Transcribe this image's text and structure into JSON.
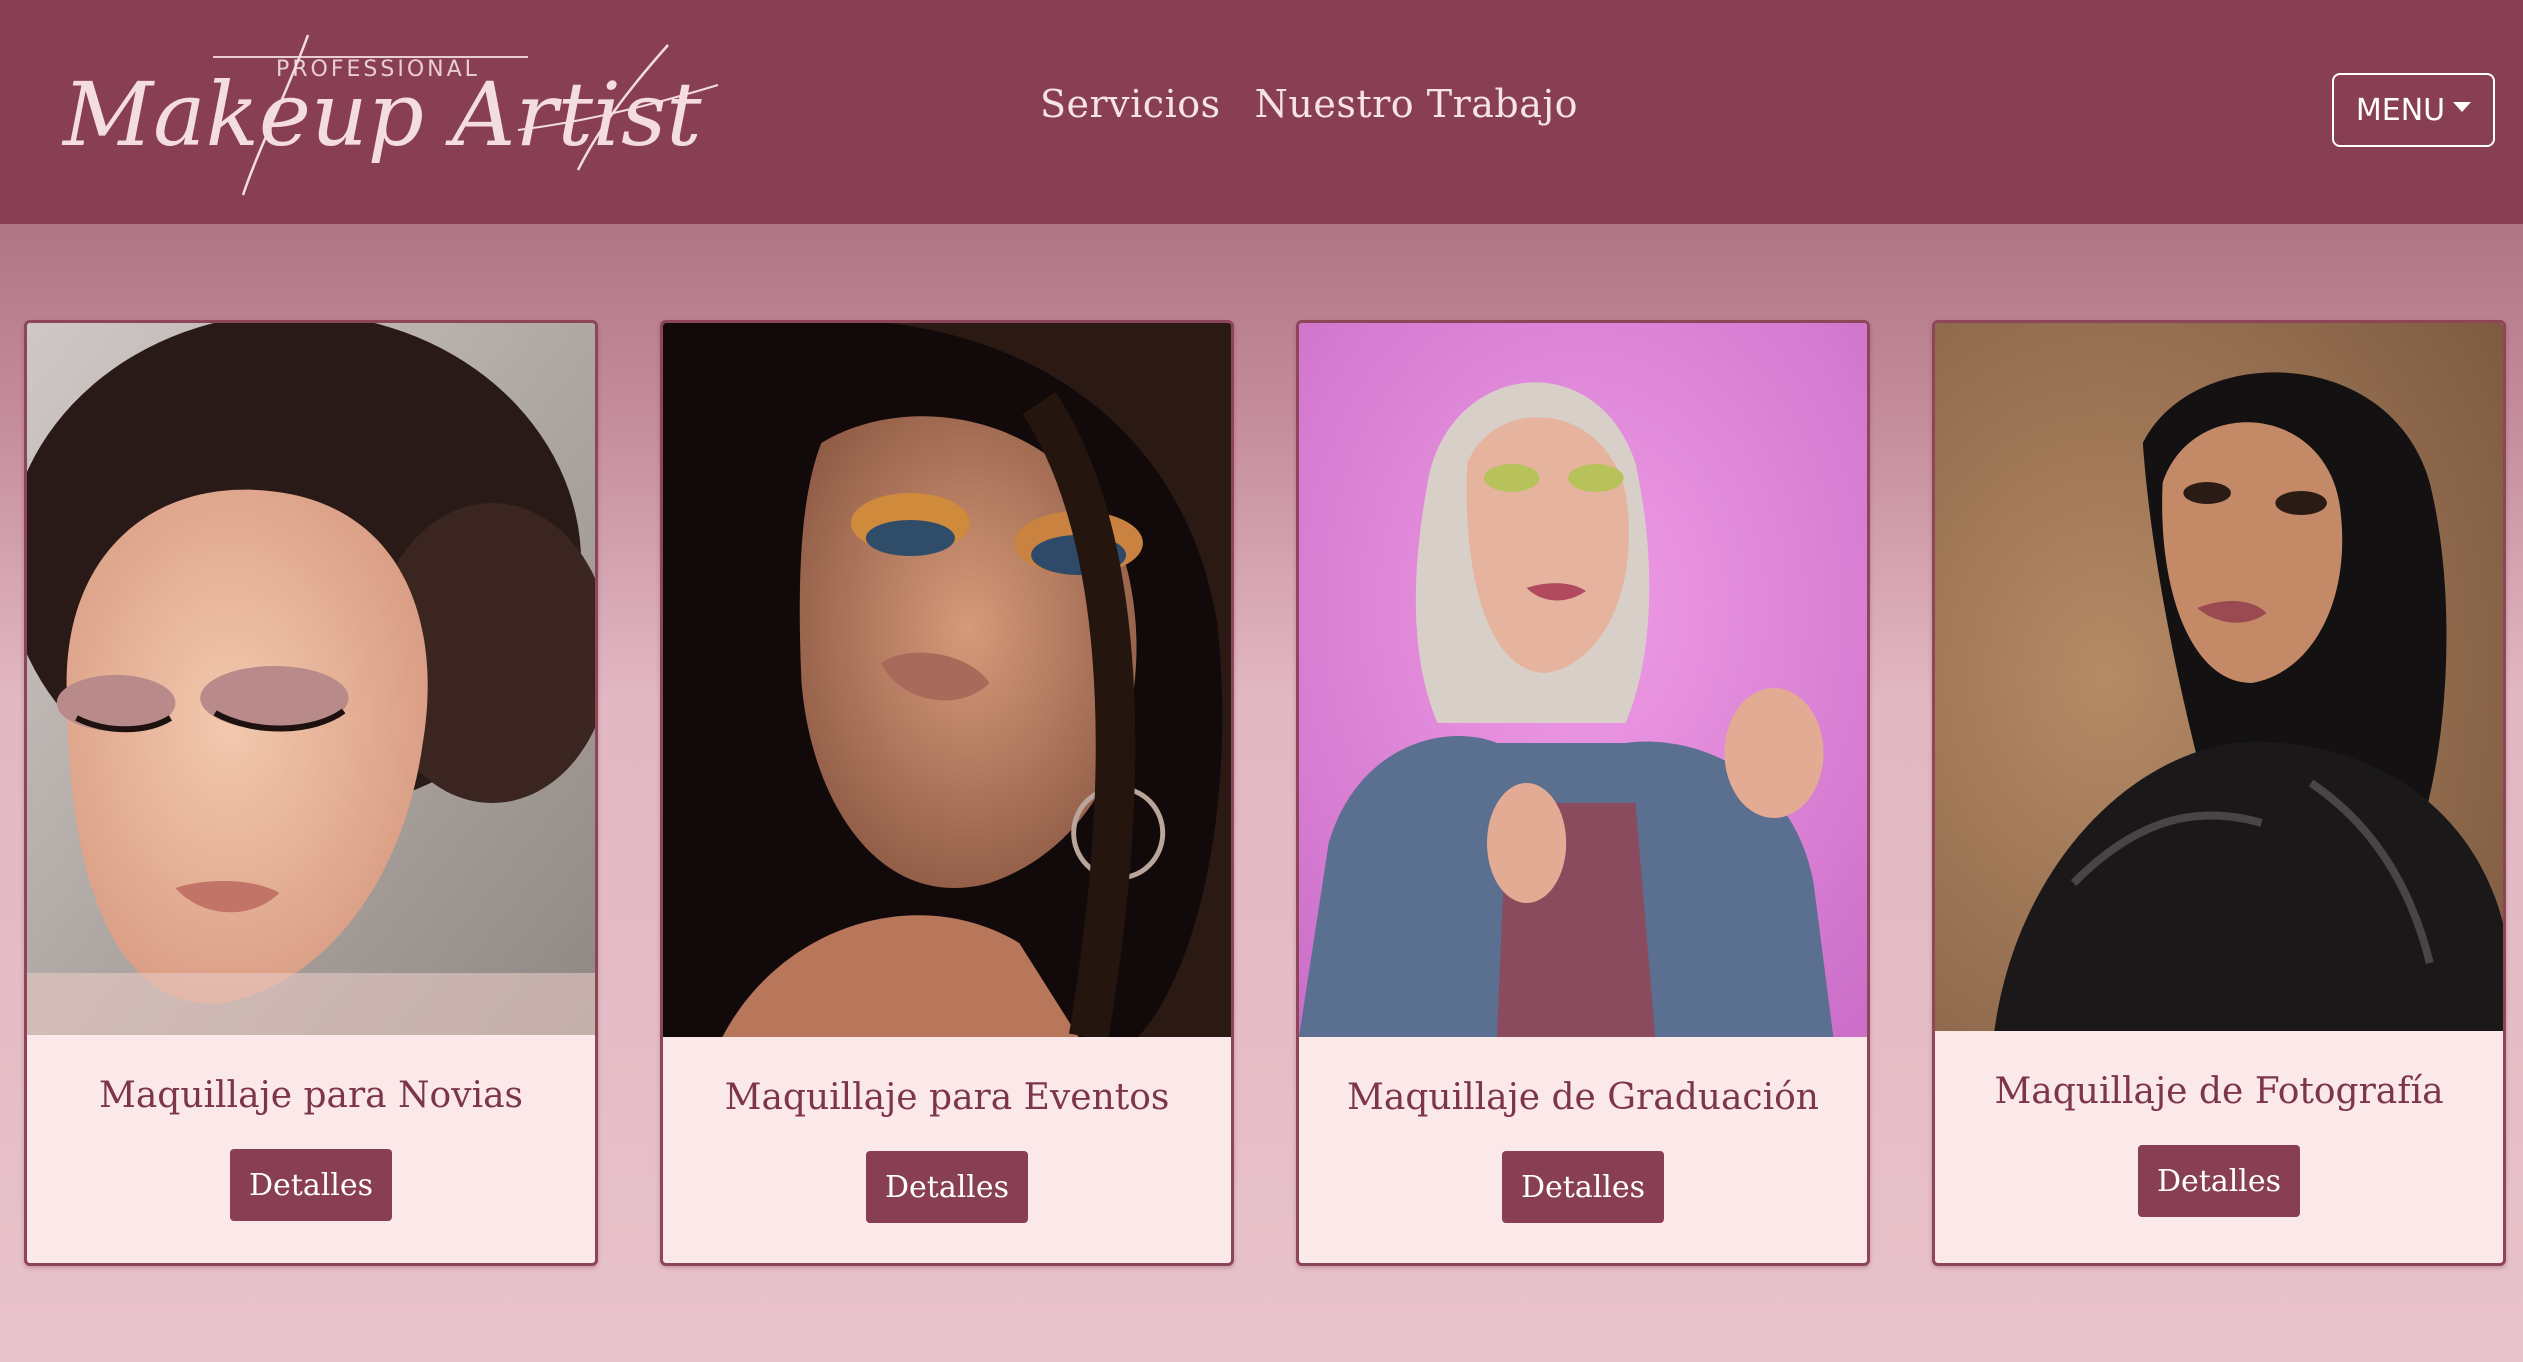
{
  "header": {
    "logo_small_text": "PROFESSIONAL",
    "logo_script_text": "Makeup Artist",
    "nav": [
      {
        "label": "Servicios"
      },
      {
        "label": "Nuestro Trabajo"
      }
    ],
    "menu_label": "MENU",
    "menu_icon": "caret-down-icon"
  },
  "colors": {
    "brand": "#893f53",
    "card_bg": "#fbe9ea",
    "title_text": "#7d3649"
  },
  "cards": [
    {
      "title": "Maquillaje para Novias",
      "button": "Detalles"
    },
    {
      "title": "Maquillaje para Eventos",
      "button": "Detalles"
    },
    {
      "title": "Maquillaje de Graduación",
      "button": "Detalles"
    },
    {
      "title": "Maquillaje de Fotografía",
      "button": "Detalles"
    }
  ]
}
